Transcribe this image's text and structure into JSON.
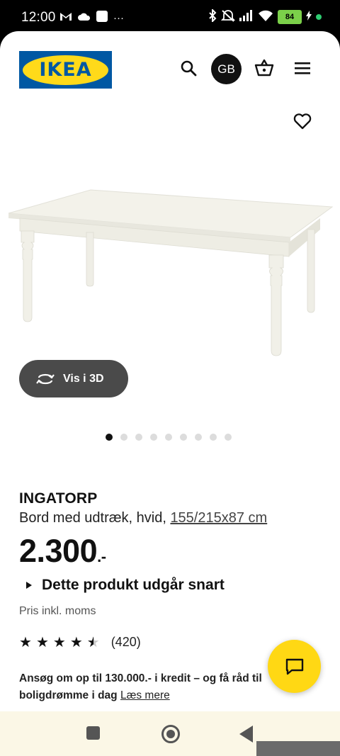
{
  "status_bar": {
    "time": "12:00",
    "left_icons": [
      "gmail-icon",
      "cloud-icon",
      "app-icon",
      "more-icon"
    ],
    "more_text": "···",
    "battery": "84",
    "right_icons": [
      "bluetooth-icon",
      "mute-icon",
      "signal-icon",
      "wifi-icon",
      "battery-icon",
      "charging-icon"
    ]
  },
  "header": {
    "logo_text": "IKEA",
    "search_icon": "search-icon",
    "country": "GB",
    "cart_icon": "shopping-basket-icon",
    "menu_icon": "hamburger-menu-icon"
  },
  "gallery": {
    "favorite_icon": "heart-icon",
    "view3d_label": "Vis i 3D",
    "view3d_icon": "rotate-3d-icon",
    "total_images": 9,
    "active_index": 0
  },
  "product": {
    "name": "INGATORP",
    "description": "Bord med udtræk, hvid,",
    "dimensions": "155/215x87 cm",
    "price_main": "2.300",
    "price_suffix": ".-",
    "status": "Dette produkt udgår snart",
    "vat_note": "Pris inkl. moms",
    "rating": 4.5,
    "rating_max": 5,
    "review_count": "(420)"
  },
  "credit": {
    "text": "Ansøg om op til 130.000.- i kredit – og få råd til boligdrømme i dag",
    "link": "Læs mere"
  },
  "chat": {
    "icon": "chat-icon"
  },
  "colors": {
    "ikea_blue": "#0058a3",
    "ikea_yellow": "#ffda1a",
    "chat_yellow": "#ffd814",
    "button_dark": "#4a4a4a"
  },
  "nav_bar": {
    "icons": [
      "recent-apps-icon",
      "home-icon",
      "back-icon"
    ]
  }
}
